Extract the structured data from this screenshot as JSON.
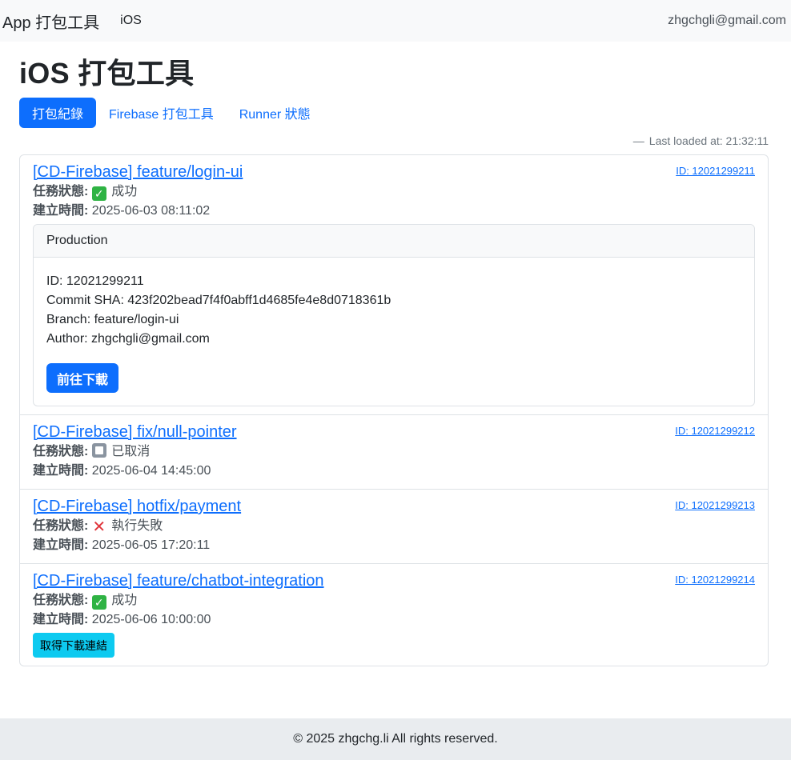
{
  "navbar": {
    "brand": "App 打包工具",
    "link": "iOS",
    "user": "zhgchgli@gmail.com"
  },
  "page": {
    "title": "iOS 打包工具",
    "tabs": [
      {
        "label": "打包紀錄",
        "active": true
      },
      {
        "label": "Firebase 打包工具",
        "active": false
      },
      {
        "label": "Runner 狀態",
        "active": false
      }
    ],
    "last_loaded_dash": "—",
    "last_loaded": "Last loaded at: 21:32:11"
  },
  "labels": {
    "status": "任務狀態:",
    "created": "建立時間:"
  },
  "items": [
    {
      "title": "[CD-Firebase] feature/login-ui",
      "id_link": "ID: 12021299211",
      "status_icon": "check-icon",
      "status": "成功",
      "created": "2025-06-03 08:11:02",
      "detail": {
        "header": "Production",
        "id": "ID: 12021299211",
        "sha": "Commit SHA: 423f202bead7f4f0abff1d4685fe4e8d0718361b",
        "branch": "Branch: feature/login-ui",
        "author": "Author: zhgchgli@gmail.com",
        "button": "前往下載"
      }
    },
    {
      "title": "[CD-Firebase] fix/null-pointer",
      "id_link": "ID: 12021299212",
      "status_icon": "stop-icon",
      "status": "已取消",
      "created": "2025-06-04 14:45:00"
    },
    {
      "title": "[CD-Firebase] hotfix/payment",
      "id_link": "ID: 12021299213",
      "status_icon": "cross-icon",
      "status": "執行失敗",
      "created": "2025-06-05 17:20:11"
    },
    {
      "title": "[CD-Firebase] feature/chatbot-integration",
      "id_link": "ID: 12021299214",
      "status_icon": "check-icon",
      "status": "成功",
      "created": "2025-06-06 10:00:00",
      "button": "取得下載連結"
    }
  ],
  "footer": "© 2025 zhgchg.li All rights reserved.",
  "colors": {
    "primary": "#0d6efd",
    "info": "#0dcaf0",
    "success": "#2fb344",
    "danger": "#e0343b"
  }
}
